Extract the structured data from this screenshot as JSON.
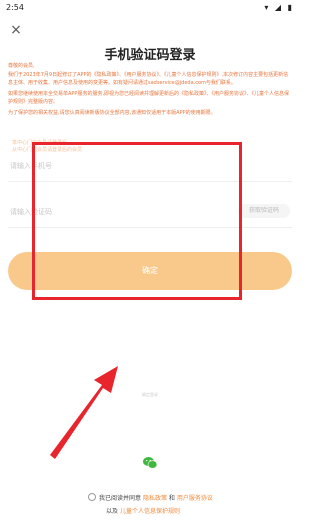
{
  "status_bar": {
    "time": "2:54",
    "icons": "▾ ◢ ▮"
  },
  "close_icon": "×",
  "title": "手机验证码登录",
  "notice": {
    "greeting": "尊敬的会员,",
    "p1": "我们于2023年7月9日起修订了APP的《隐私政策》、《用户服务协议》、《儿童个人信息保护规则》,本次修订内容主要包括更新信息主体、用于收集、用户信息及使用的变更等。如有疑问请通过sadservice@jdeda.com与我们联系。",
    "p2": "如果您继续使用本全交易单APP服务的服务,即视为您已经阅读并理解更新后的《隐私政策》、《用户服务协议》、《儿童个人信息保护规则》完整版内容。",
    "p3": "为了保护您的相关权益,请您认真阅读新版协议全部内容,该通知仅适用于本版APP的使用期限。"
  },
  "faint_lines": [
    "享中心门店会员请登录后",
    "从中心门店会员请登录后的会员"
  ],
  "phone_field": {
    "placeholder": "请输入手机号"
  },
  "code_field": {
    "placeholder": "请输入验证码",
    "button": "获取验证码"
  },
  "confirm_button": "确定",
  "small_confirm": "确定登录",
  "agreement": {
    "prefix": "我已阅读并同意",
    "privacy": "隐私政策",
    "and": "和",
    "service": "用户服务协议",
    "row2_prefix": "以及",
    "children": "儿童个人信息保护规则"
  },
  "colors": {
    "annotation_red": "#e8242c",
    "accent": "#f9c98c",
    "link": "#f08a3a"
  }
}
